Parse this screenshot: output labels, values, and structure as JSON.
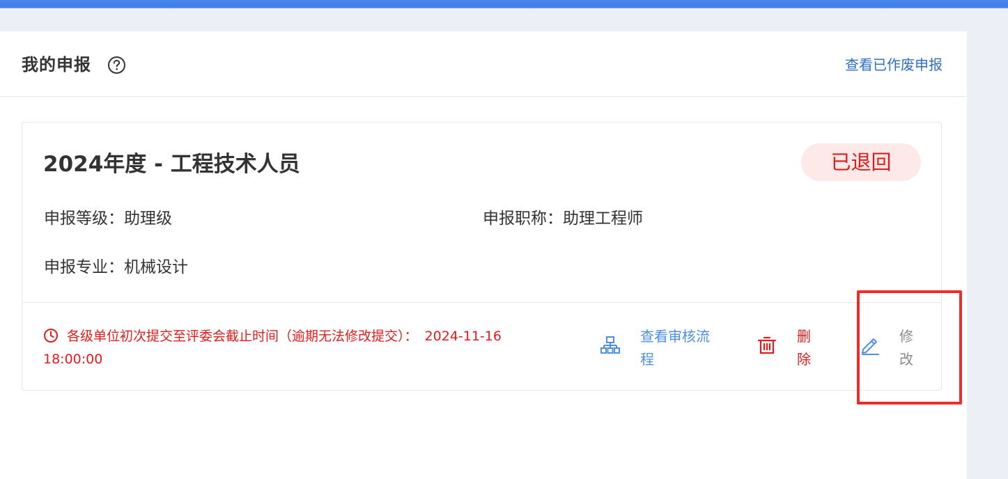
{
  "page": {
    "title": "我的申报",
    "voided_link": "查看已作废申报"
  },
  "card": {
    "title": "2024年度 - 工程技术人员",
    "status": "已退回",
    "fields": {
      "level": "申报等级：助理级",
      "job_title": "申报职称：助理工程师",
      "major": "申报专业：机械设计"
    },
    "deadline": {
      "text": "各级单位初次提交至评委会截止时间（逾期无法修改提交）：",
      "datetime": "2024-11-16 18:00:00"
    },
    "actions": {
      "view_flow": "查看审核流程",
      "delete": "删除",
      "edit": "修改"
    }
  },
  "icons": {
    "help": "question-circle-icon",
    "clock": "clock-icon",
    "flow": "sitemap-icon",
    "delete": "trash-icon",
    "edit": "pencil-icon"
  },
  "colors": {
    "link": "#2d6fc7",
    "danger": "#e31b1b",
    "status_bg": "#fde9e7",
    "action_blue": "#4d8fe0",
    "annotation": "#f22a2a"
  }
}
